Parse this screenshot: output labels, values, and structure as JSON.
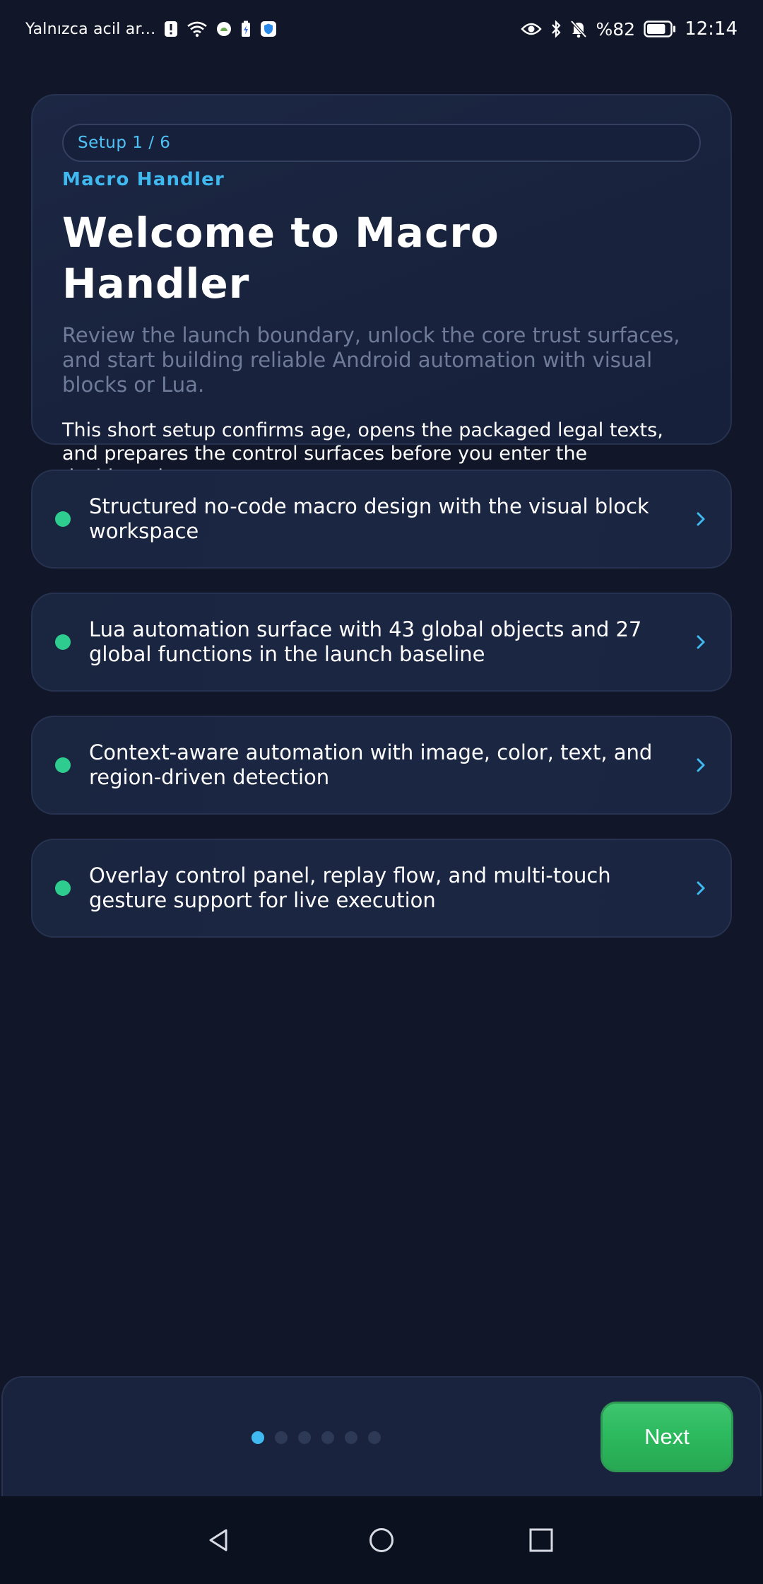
{
  "status_bar": {
    "carrier": "Yalnızca acil ar...",
    "battery_percent": "%82",
    "time": "12:14",
    "battery_level": 0.82,
    "icons": [
      "alert-icon",
      "wifi-icon",
      "android-app-icon",
      "battery-saver-icon",
      "shield-app-icon",
      "eye-icon",
      "bluetooth-icon",
      "bell-muted-icon",
      "battery-icon"
    ]
  },
  "hero": {
    "step": "Setup 1 / 6",
    "app_name": "Macro Handler",
    "title": "Welcome to Macro Handler",
    "subtitle": "Review the launch boundary, unlock the core trust surfaces, and start building reliable Android automation with visual blocks or Lua.",
    "body": "This short setup confirms age, opens the packaged legal texts, and prepares the control surfaces before you enter the dashboard."
  },
  "features": [
    {
      "text": "Structured no-code macro design with the visual block workspace"
    },
    {
      "text": "Lua automation surface with 43 global objects and 27 global functions in the launch baseline"
    },
    {
      "text": "Context-aware automation with image, color, text, and region-driven detection"
    },
    {
      "text": "Overlay control panel, replay flow, and multi-touch gesture support for live execution"
    }
  ],
  "footer": {
    "pages_total": 6,
    "current_page": 1,
    "next_label": "Next"
  },
  "colors": {
    "background": "#111729",
    "card": "#1a2540",
    "accent_blue": "#3fb9ef",
    "bullet_green": "#2ecc8f",
    "next_green": "#2dba5f"
  }
}
